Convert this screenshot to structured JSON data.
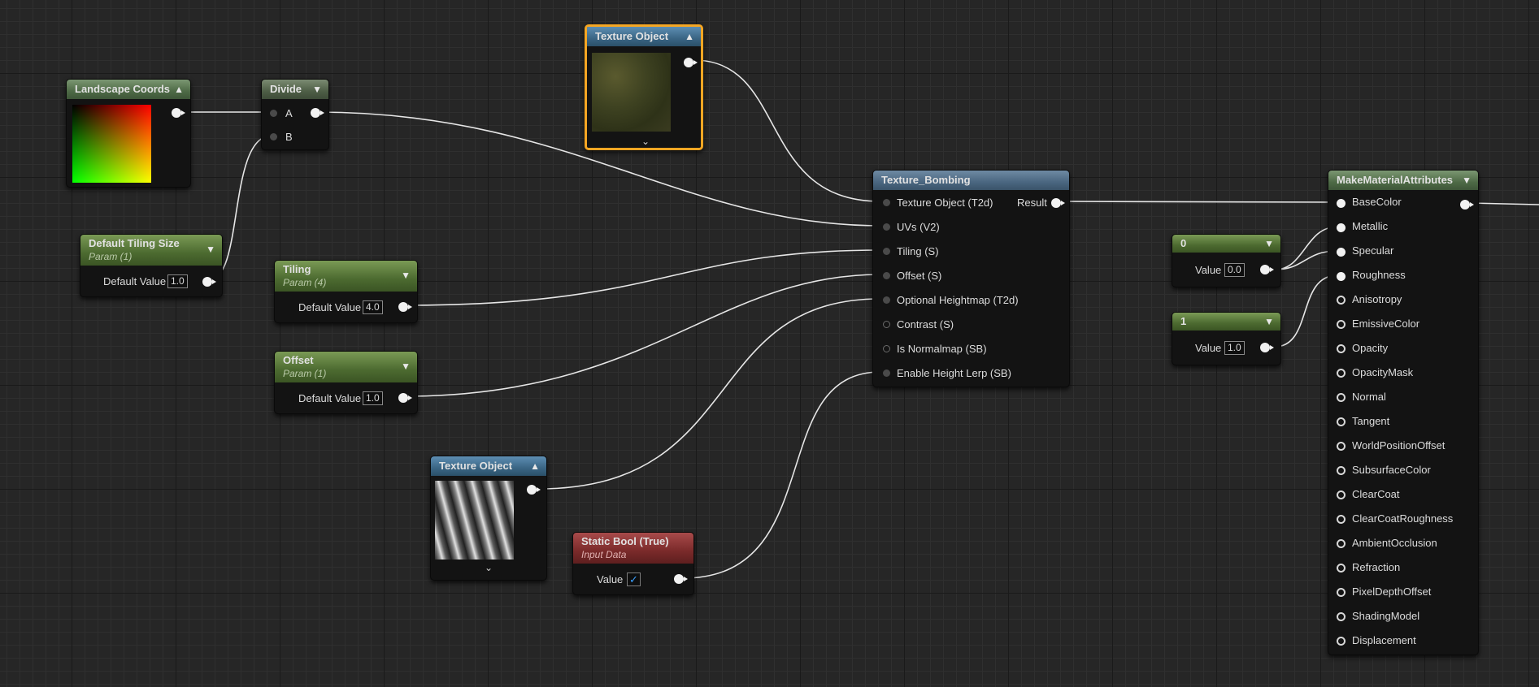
{
  "nodes": {
    "landscape_coords": {
      "title": "Landscape Coords"
    },
    "divide": {
      "title": "Divide",
      "pin_a": "A",
      "pin_b": "B"
    },
    "texture_object_top": {
      "title": "Texture Object"
    },
    "default_tiling_size": {
      "title": "Default Tiling Size",
      "subtitle": "Param (1)",
      "value_label": "Default Value",
      "value": "1.0"
    },
    "tiling": {
      "title": "Tiling",
      "subtitle": "Param (4)",
      "value_label": "Default Value",
      "value": "4.0"
    },
    "offset": {
      "title": "Offset",
      "subtitle": "Param (1)",
      "value_label": "Default Value",
      "value": "1.0"
    },
    "texture_object_bottom": {
      "title": "Texture Object"
    },
    "static_bool": {
      "title": "Static Bool (True)",
      "subtitle": "Input Data",
      "value_label": "Value",
      "checked": true
    },
    "texture_bombing": {
      "title": "Texture_Bombing",
      "result_label": "Result",
      "inputs": [
        "Texture Object (T2d)",
        "UVs (V2)",
        "Tiling (S)",
        "Offset (S)",
        "Optional Heightmap (T2d)",
        "Contrast (S)",
        "Is Normalmap (SB)",
        "Enable Height Lerp (SB)"
      ]
    },
    "const_0": {
      "title": "0",
      "value_label": "Value",
      "value": "0.0"
    },
    "const_1": {
      "title": "1",
      "value_label": "Value",
      "value": "1.0"
    },
    "make_material_attributes": {
      "title": "MakeMaterialAttributes",
      "inputs": [
        "BaseColor",
        "Metallic",
        "Specular",
        "Roughness",
        "Anisotropy",
        "EmissiveColor",
        "Opacity",
        "OpacityMask",
        "Normal",
        "Tangent",
        "WorldPositionOffset",
        "SubsurfaceColor",
        "ClearCoat",
        "ClearCoatRoughness",
        "AmbientOcclusion",
        "Refraction",
        "PixelDepthOffset",
        "ShadingModel",
        "Displacement"
      ]
    }
  },
  "colors": {
    "grid_background": "#262626",
    "param_header": "#5a7a3a",
    "texture_header": "#3a6584",
    "function_header": "#4a6680",
    "static_bool_header": "#7a2a2a",
    "selection_outline": "#f5a623",
    "wire": "#e8e8e8"
  },
  "icons": {
    "collapse": "chevron-up-icon",
    "expand": "chevron-down-icon",
    "output_pin": "exec-output-pin-icon",
    "checkbox": "checkmark-icon"
  }
}
